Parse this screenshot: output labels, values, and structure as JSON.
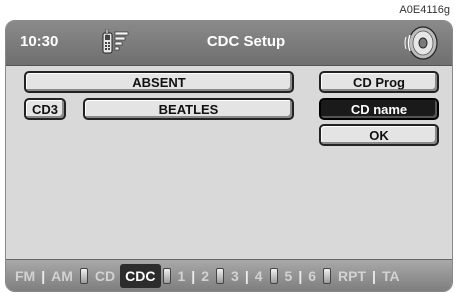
{
  "image_code": "A0E4116g",
  "header": {
    "time": "10:30",
    "title": "CDC Setup",
    "left_icon": "phone-signal-icon",
    "right_icon": "disc-icon"
  },
  "main": {
    "status_label": "ABSENT",
    "disc_label": "CD3",
    "name_label": "BEATLES"
  },
  "menu": {
    "items": [
      "CD Prog",
      "CD name",
      "OK"
    ],
    "selected": "CD name"
  },
  "bottom": {
    "fm": "FM",
    "am": "AM",
    "cd": "CD",
    "cdc": "CDC",
    "p1": "1",
    "p2": "2",
    "p3": "3",
    "p4": "4",
    "p5": "5",
    "p6": "6",
    "rpt": "RPT",
    "ta": "TA",
    "active": "CDC"
  },
  "colors": {
    "header": "#7a7a7a",
    "screen": "#d9d9d9",
    "selected_button": "#1a1a1a"
  }
}
